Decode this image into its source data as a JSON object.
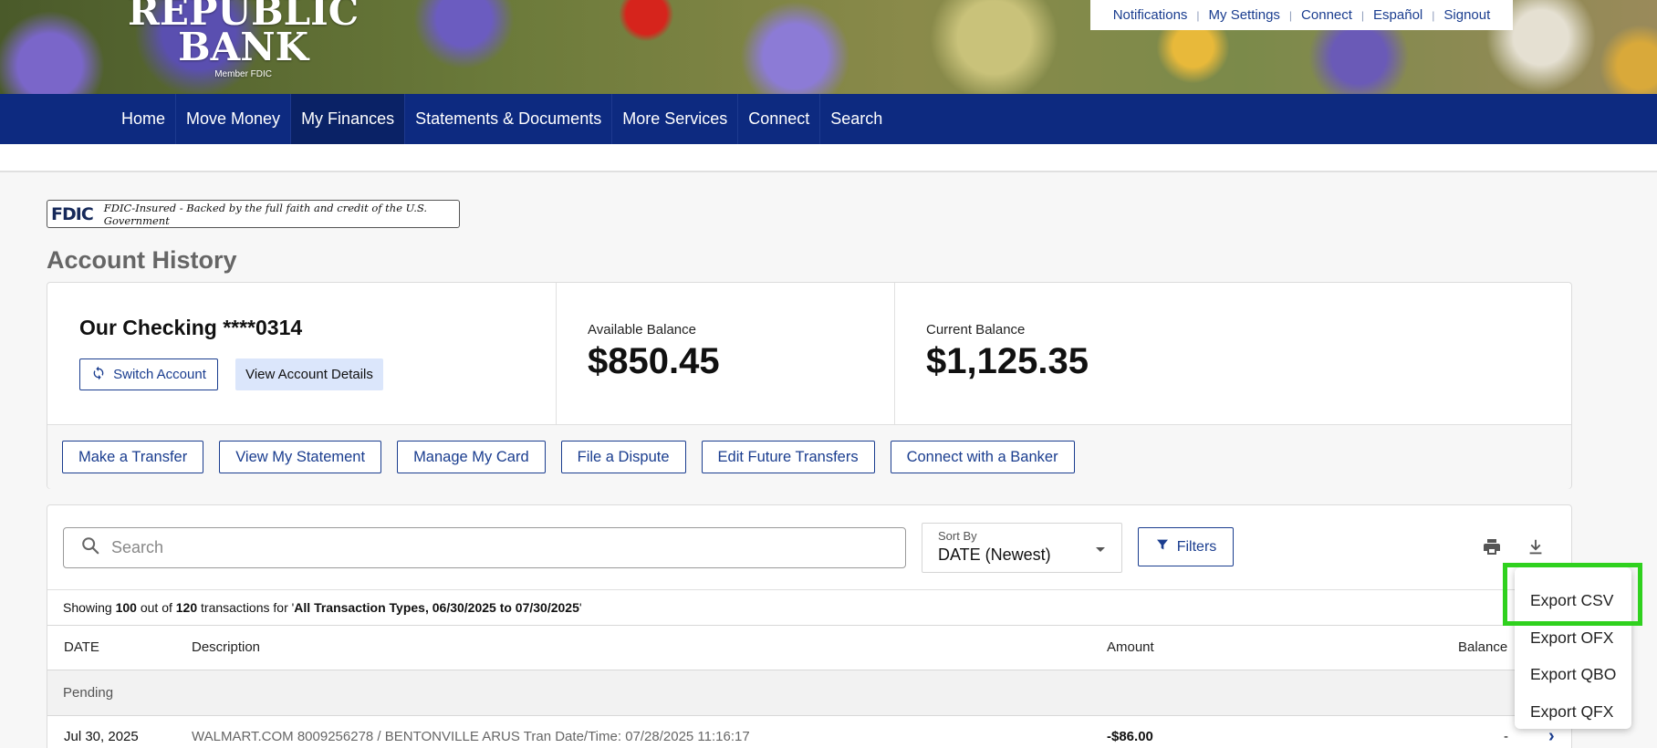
{
  "brand": {
    "line1": "REPUBLIC",
    "line2": "BANK",
    "member": "Member FDIC"
  },
  "top_links": [
    "Notifications",
    "My Settings",
    "Connect",
    "Español",
    "Signout"
  ],
  "nav": {
    "items": [
      "Home",
      "Move Money",
      "My Finances",
      "Statements & Documents",
      "More Services",
      "Connect",
      "Search"
    ],
    "active": "My Finances"
  },
  "fdic": {
    "mark": "FDIC",
    "text": "FDIC-Insured - Backed by the full faith and credit of the U.S. Government"
  },
  "page_title": "Account History",
  "account": {
    "name": "Our Checking ****0314",
    "switch_label": "Switch Account",
    "details_label": "View Account Details",
    "available_label": "Available Balance",
    "available_value": "$850.45",
    "current_label": "Current Balance",
    "current_value": "$1,125.35"
  },
  "actions": [
    "Make a Transfer",
    "View My Statement",
    "Manage My Card",
    "File a Dispute",
    "Edit Future Transfers",
    "Connect with a Banker"
  ],
  "transactions": {
    "search_placeholder": "Search",
    "sort_label": "Sort By",
    "sort_value": "DATE (Newest)",
    "filters_label": "Filters",
    "showing": {
      "prefix": "Showing ",
      "shown": "100",
      "middle": " out of ",
      "total": "120",
      "suffix_pre": " transactions for '",
      "criteria": "All Transaction Types, 06/30/2025 to 07/30/2025",
      "suffix_post": "'"
    },
    "columns": {
      "date": "DATE",
      "description": "Description",
      "amount": "Amount",
      "balance": "Balance"
    },
    "group_label": "Pending",
    "rows": [
      {
        "date": "Jul 30, 2025",
        "description": "WALMART.COM 8009256278 / BENTONVILLE ARUS Tran Date/Time: 07/28/2025 11:16:17",
        "amount": "-$86.00",
        "balance": "-"
      }
    ]
  },
  "export_menu": {
    "options": [
      "Export CSV",
      "Export OFX",
      "Export QBO",
      "Export QFX"
    ],
    "highlighted": "Export CSV",
    "highlight_color": "#2fd11e"
  },
  "colors": {
    "nav_bg": "#0d2a80",
    "link": "#1a3d8f",
    "details_btn_bg": "#dbe6fb"
  }
}
